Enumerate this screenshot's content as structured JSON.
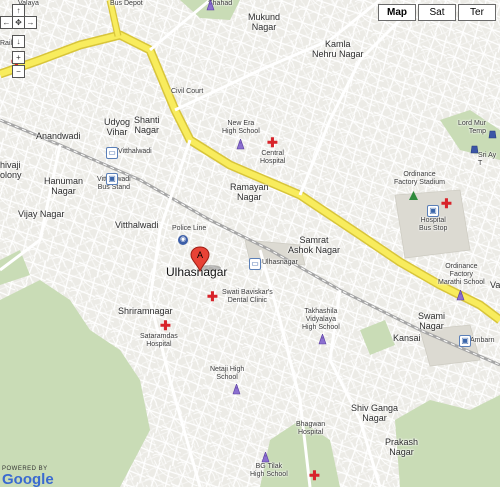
{
  "map_type": {
    "buttons": [
      {
        "label": "Map",
        "active": true
      },
      {
        "label": "Sat",
        "active": false
      },
      {
        "label": "Ter",
        "active": false
      }
    ]
  },
  "marker": {
    "letter": "A",
    "color": "#e84236"
  },
  "colors": {
    "highway": "#f8ec5d",
    "highway_edge": "#d8c53a",
    "green": "#c9dcb6",
    "rail": "#a6a6a6",
    "background": "#ecebe6"
  },
  "labels": {
    "valaya": "Valaya",
    "railw": "Railw",
    "bus_depot": "Bus Depot",
    "shahad": "Shahad",
    "mukund": "Mukund\nNagar",
    "kamla": "Kamla\nNehru Nagar",
    "lord": "Lord Mur\nTemp",
    "civil_court": "Civil Court",
    "anandwadi": "Anandwadi",
    "udyog": "Udyog\nVihar",
    "shanti": "Shanti\nNagar",
    "new_era": "New Era\nHigh School",
    "central_hosp": "Central\nHospital",
    "sri_ay": "Sri Ay\nT",
    "shivaji": "hivaji\nolony",
    "vitthalwadi_stn": "Vitthalwadi",
    "hanuman": "Hanuman\nNagar",
    "vitthalwadi_bus": "Vitthalwadi\nBus Stand",
    "ordinance_stadium": "Ordinance\nFactory Stadium",
    "vijay": "Vijay Nagar",
    "ramayan": "Ramayan\nNagar",
    "hospital_bus": "Hospital\nBus Stop",
    "vitthalwadi": "Vitthalwadi",
    "police_line": "Police Line",
    "samrat": "Samrat\nAshok Nagar",
    "ulhasnagar_stn": "Ulhasnagar",
    "ordinance_marathi": "Ordinance\nFactory\nMarathi School",
    "ulhasnagar": "Ulhasnagar",
    "swati": "Swati Baviskar's\nDental Clinic",
    "va": "Va",
    "shriramnagar": "Shriramnagar",
    "takhashila": "Takhashila\nVidyalaya\nHigh School",
    "swami": "Swami\nNagar",
    "kansai": "Kansai",
    "sataramdas": "Sataramdas\nHospital",
    "ambarn": "Ambarn",
    "netaji": "Netaji High\nSchool",
    "shiv_ganga": "Shiv Ganga\nNagar",
    "bhagwan": "Bhagwan\nHospital",
    "prakash": "Prakash\nNagar",
    "bg_tilak": "BG Tilak\nHigh School",
    "powered_by": "POWERED BY",
    "google": "Google"
  }
}
